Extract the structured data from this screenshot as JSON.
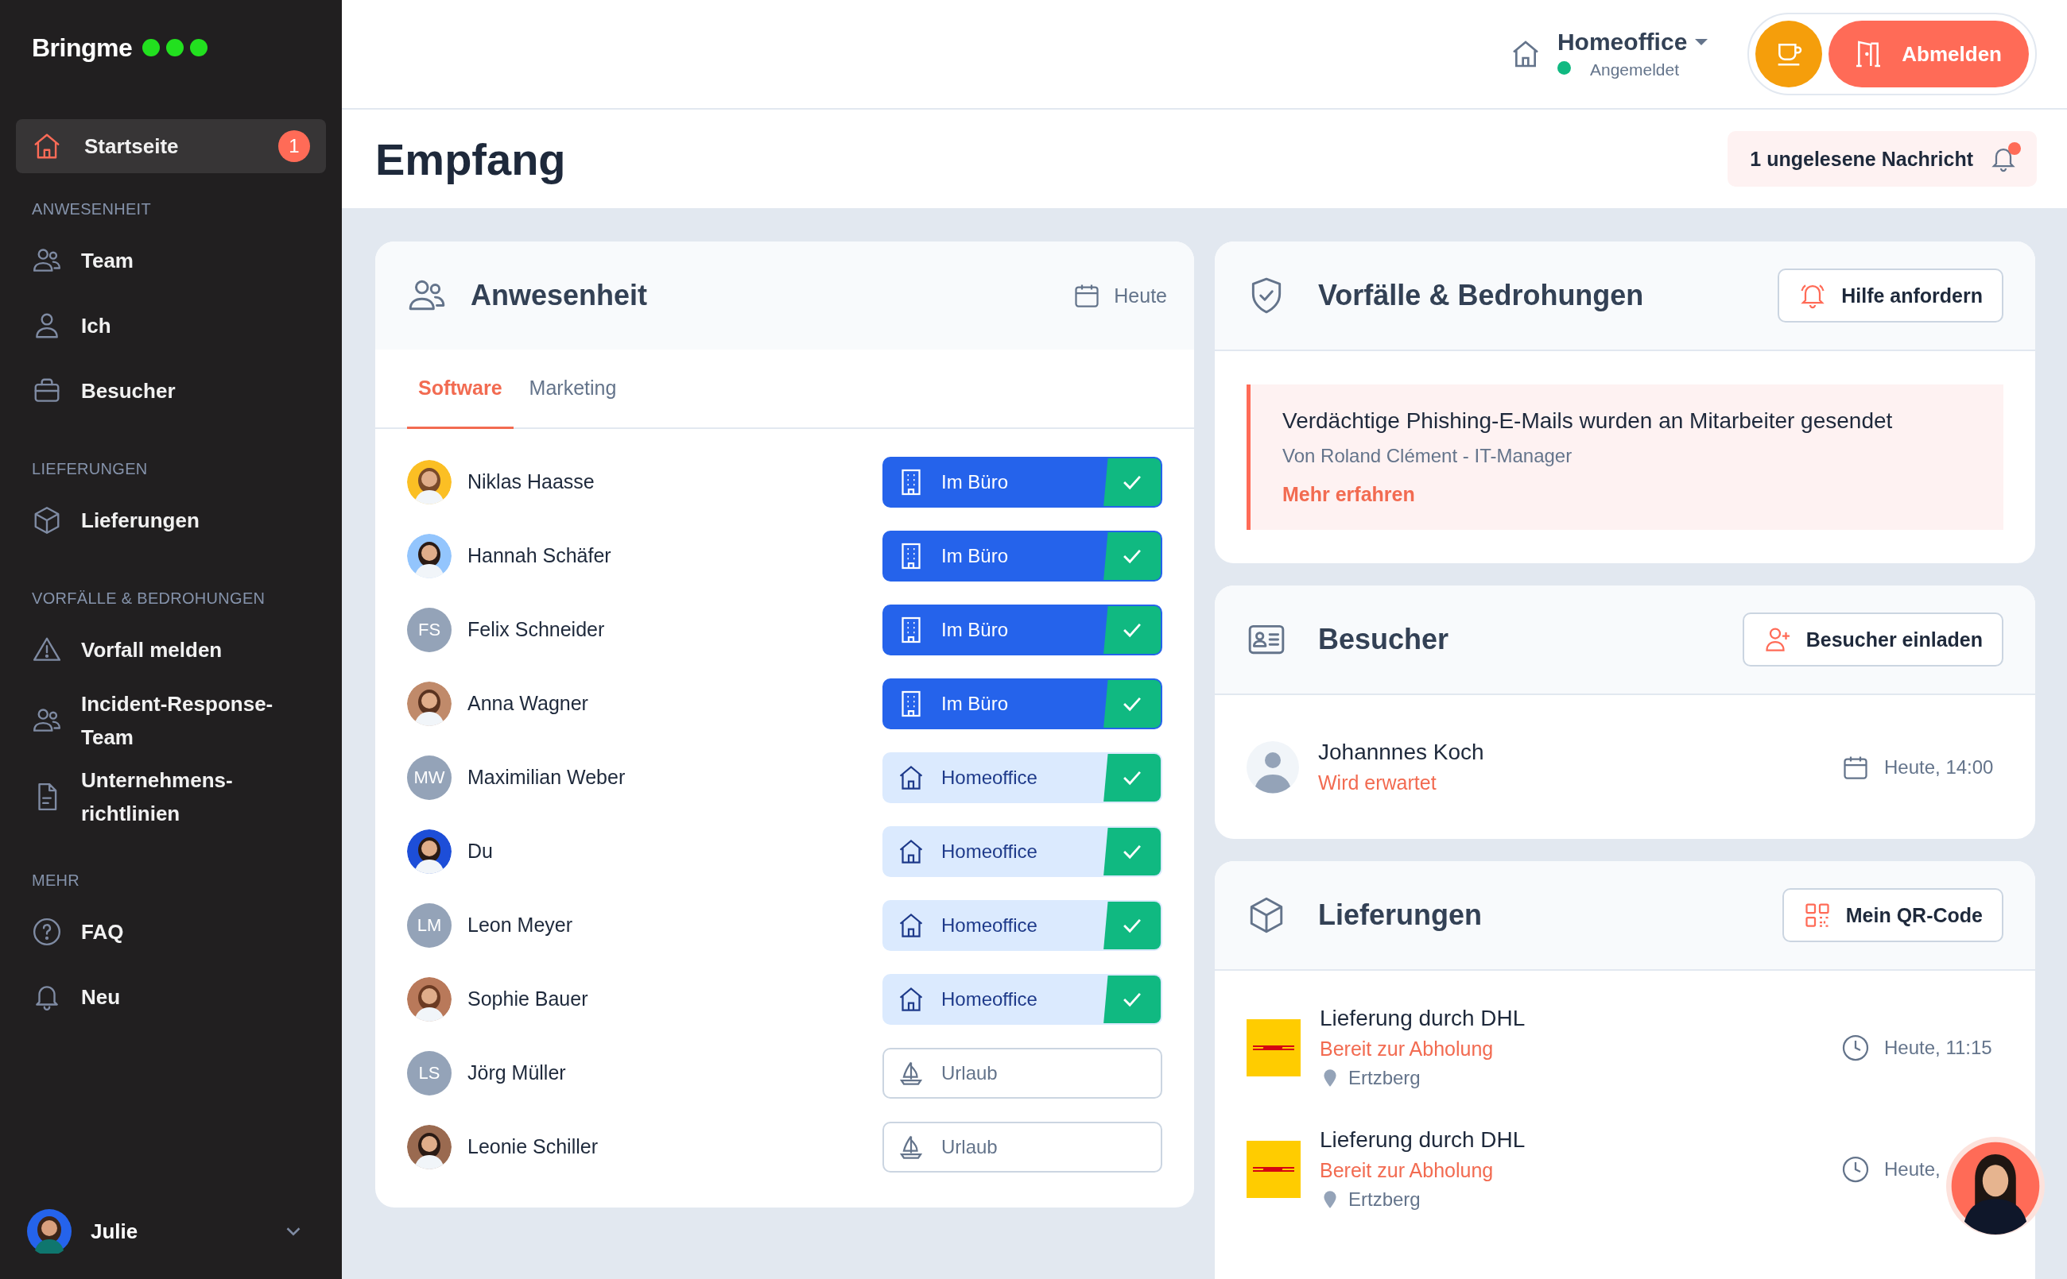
{
  "sidebar": {
    "logo": "Bringme",
    "home": {
      "label": "Startseite",
      "badge": "1",
      "selected": true
    },
    "sections": [
      {
        "heading": "ANWESENHEIT",
        "items": [
          {
            "label": "Team",
            "selected": false
          },
          {
            "label": "Ich",
            "selected": false
          },
          {
            "label": "Besucher",
            "selected": false
          }
        ]
      },
      {
        "heading": "LIEFERUNGEN",
        "items": [
          {
            "label": "Lieferungen",
            "selected": false
          }
        ]
      },
      {
        "heading": "VORFÄLLE & BEDROHUNGEN",
        "items": [
          {
            "label": "Vorfall melden",
            "selected": false
          },
          {
            "label": "Incident-Response-Team",
            "selected": false
          },
          {
            "label": "Unternehmens-richtlinien",
            "selected": false
          }
        ]
      },
      {
        "heading": "MEHR",
        "items": [
          {
            "label": "FAQ",
            "selected": false
          },
          {
            "label": "Neu",
            "selected": false
          }
        ]
      }
    ],
    "user": {
      "name": "Julie"
    }
  },
  "header": {
    "location": "Homeoffice",
    "status": "Angemeldet",
    "online": true,
    "logout": "Abmelden"
  },
  "page_title": "Empfang",
  "notifications": {
    "label": "1 ungelesene Nachricht",
    "unread": true
  },
  "attendance": {
    "title": "Anwesenheit",
    "date": "Heute",
    "tabs": [
      {
        "label": "Software",
        "selected": true
      },
      {
        "label": "Marketing",
        "selected": false
      }
    ],
    "people": [
      {
        "name": "Niklas Haasse",
        "status": {
          "kind": "office",
          "label": "Im Büro",
          "checked": true
        }
      },
      {
        "name": "Hannah Schäfer",
        "status": {
          "kind": "office",
          "label": "Im Büro",
          "checked": true
        }
      },
      {
        "name": "Felix Schneider",
        "avatar": {
          "kind": "initials",
          "initials": "FS"
        },
        "status": {
          "kind": "office",
          "label": "Im Büro",
          "checked": true
        }
      },
      {
        "name": "Anna Wagner",
        "status": {
          "kind": "office",
          "label": "Im Büro",
          "checked": true
        }
      },
      {
        "name": "Maximilian Weber",
        "avatar": {
          "kind": "initials",
          "initials": "MW"
        },
        "status": {
          "kind": "homeoffice",
          "label": "Homeoffice",
          "checked": true
        }
      },
      {
        "name": "Du",
        "status": {
          "kind": "homeoffice",
          "label": "Homeoffice",
          "checked": true
        }
      },
      {
        "name": "Leon Meyer",
        "avatar": {
          "kind": "initials",
          "initials": "LM"
        },
        "status": {
          "kind": "homeoffice",
          "label": "Homeoffice",
          "checked": true
        }
      },
      {
        "name": "Sophie Bauer",
        "status": {
          "kind": "homeoffice",
          "label": "Homeoffice",
          "checked": true
        }
      },
      {
        "name": "Jörg Müller",
        "avatar": {
          "kind": "initials",
          "initials": "LS"
        },
        "status": {
          "kind": "vacation",
          "label": "Urlaub",
          "checked": false
        }
      },
      {
        "name": "Leonie Schiller",
        "status": {
          "kind": "vacation",
          "label": "Urlaub",
          "checked": false
        }
      }
    ]
  },
  "incidents": {
    "title": "Vorfälle & Bedrohungen",
    "action": "Hilfe anfordern",
    "alerts": [
      {
        "title": "Verdächtige Phishing-E-Mails wurden an Mitarbeiter gesendet",
        "author": "Von Roland Clément - IT-Manager",
        "link": "Mehr erfahren"
      }
    ]
  },
  "visitors": {
    "title": "Besucher",
    "action": "Besucher einladen",
    "items": [
      {
        "name": "Johannnes Koch",
        "status": "Wird erwartet",
        "time": "Heute, 14:00"
      }
    ]
  },
  "deliveries": {
    "title": "Lieferungen",
    "action": "Mein QR-Code",
    "items": [
      {
        "title": "Lieferung durch DHL",
        "status": "Bereit zur Abholung",
        "location": "Ertzberg",
        "time": "Heute, 11:15"
      },
      {
        "title": "Lieferung durch DHL",
        "status": "Bereit zur Abholung",
        "location": "Ertzberg",
        "time": "Heute,"
      }
    ]
  }
}
